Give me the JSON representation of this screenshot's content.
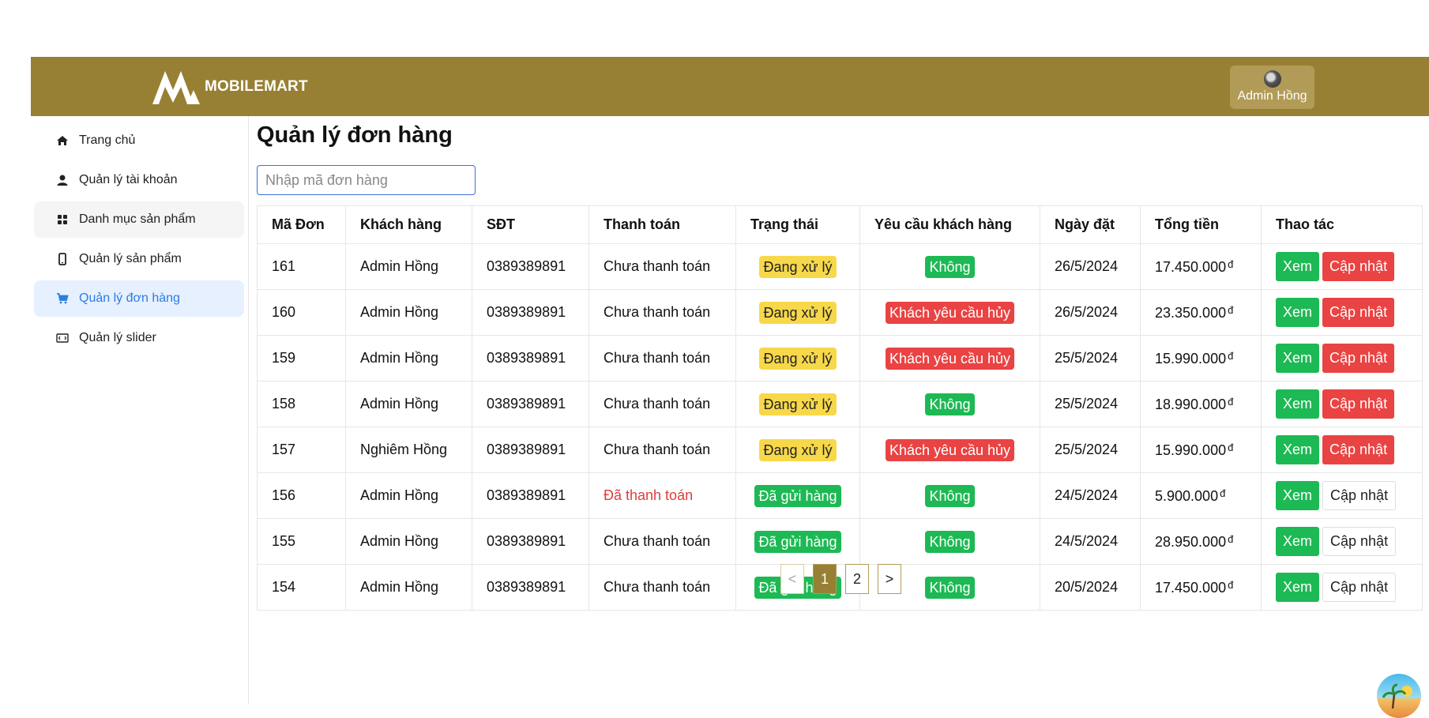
{
  "app": {
    "brand": "MOBILEMART",
    "user_name": "Admin Hồng"
  },
  "sidebar": {
    "items": [
      {
        "label": "Trang chủ",
        "icon": "home-icon"
      },
      {
        "label": "Quản lý tài khoản",
        "icon": "user-icon"
      },
      {
        "label": "Danh mục sản phẩm",
        "icon": "grid-icon"
      },
      {
        "label": "Quản lý sản phẩm",
        "icon": "phone-icon"
      },
      {
        "label": "Quản lý đơn hàng",
        "icon": "cart-icon",
        "active": true
      },
      {
        "label": "Quản lý slider",
        "icon": "slider-icon"
      }
    ]
  },
  "main": {
    "title": "Quản lý đơn hàng",
    "search_placeholder": "Nhập mã đơn hàng",
    "columns": [
      "Mã Đơn",
      "Khách hàng",
      "SĐT",
      "Thanh toán",
      "Trạng thái",
      "Yêu cầu khách hàng",
      "Ngày đặt",
      "Tổng tiền",
      "Thao tác"
    ],
    "view_label": "Xem",
    "update_label": "Cập nhật",
    "currency": "đ",
    "rows": [
      {
        "id": "161",
        "customer": "Admin Hồng",
        "phone": "0389389891",
        "payment": "Chưa thanh toán",
        "status": "Đang xử lý",
        "request": "Không",
        "date": "26/5/2024",
        "total": "17.450.000"
      },
      {
        "id": "160",
        "customer": "Admin Hồng",
        "phone": "0389389891",
        "payment": "Chưa thanh toán",
        "status": "Đang xử lý",
        "request": "Khách yêu cầu hủy",
        "date": "26/5/2024",
        "total": "23.350.000"
      },
      {
        "id": "159",
        "customer": "Admin Hồng",
        "phone": "0389389891",
        "payment": "Chưa thanh toán",
        "status": "Đang xử lý",
        "request": "Khách yêu cầu hủy",
        "date": "25/5/2024",
        "total": "15.990.000"
      },
      {
        "id": "158",
        "customer": "Admin Hồng",
        "phone": "0389389891",
        "payment": "Chưa thanh toán",
        "status": "Đang xử lý",
        "request": "Không",
        "date": "25/5/2024",
        "total": "18.990.000"
      },
      {
        "id": "157",
        "customer": "Nghiêm Hồng",
        "phone": "0389389891",
        "payment": "Chưa thanh toán",
        "status": "Đang xử lý",
        "request": "Khách yêu cầu hủy",
        "date": "25/5/2024",
        "total": "15.990.000"
      },
      {
        "id": "156",
        "customer": "Admin Hồng",
        "phone": "0389389891",
        "payment": "Đã thanh toán",
        "status": "Đã gửi hàng",
        "request": "Không",
        "date": "24/5/2024",
        "total": "5.900.000"
      },
      {
        "id": "155",
        "customer": "Admin Hồng",
        "phone": "0389389891",
        "payment": "Chưa thanh toán",
        "status": "Đã gửi hàng",
        "request": "Không",
        "date": "24/5/2024",
        "total": "28.950.000"
      },
      {
        "id": "154",
        "customer": "Admin Hồng",
        "phone": "0389389891",
        "payment": "Chưa thanh toán",
        "status": "Đã gửi hàng",
        "request": "Không",
        "date": "20/5/2024",
        "total": "17.450.000"
      }
    ]
  },
  "pagination": {
    "prev": "<",
    "pages": [
      "1",
      "2"
    ],
    "current": "1",
    "next": ">"
  },
  "colors": {
    "header": "#978033",
    "accent": "#2a7de1",
    "green": "#1db954",
    "red": "#e94343",
    "yellow": "#f7d84a"
  }
}
